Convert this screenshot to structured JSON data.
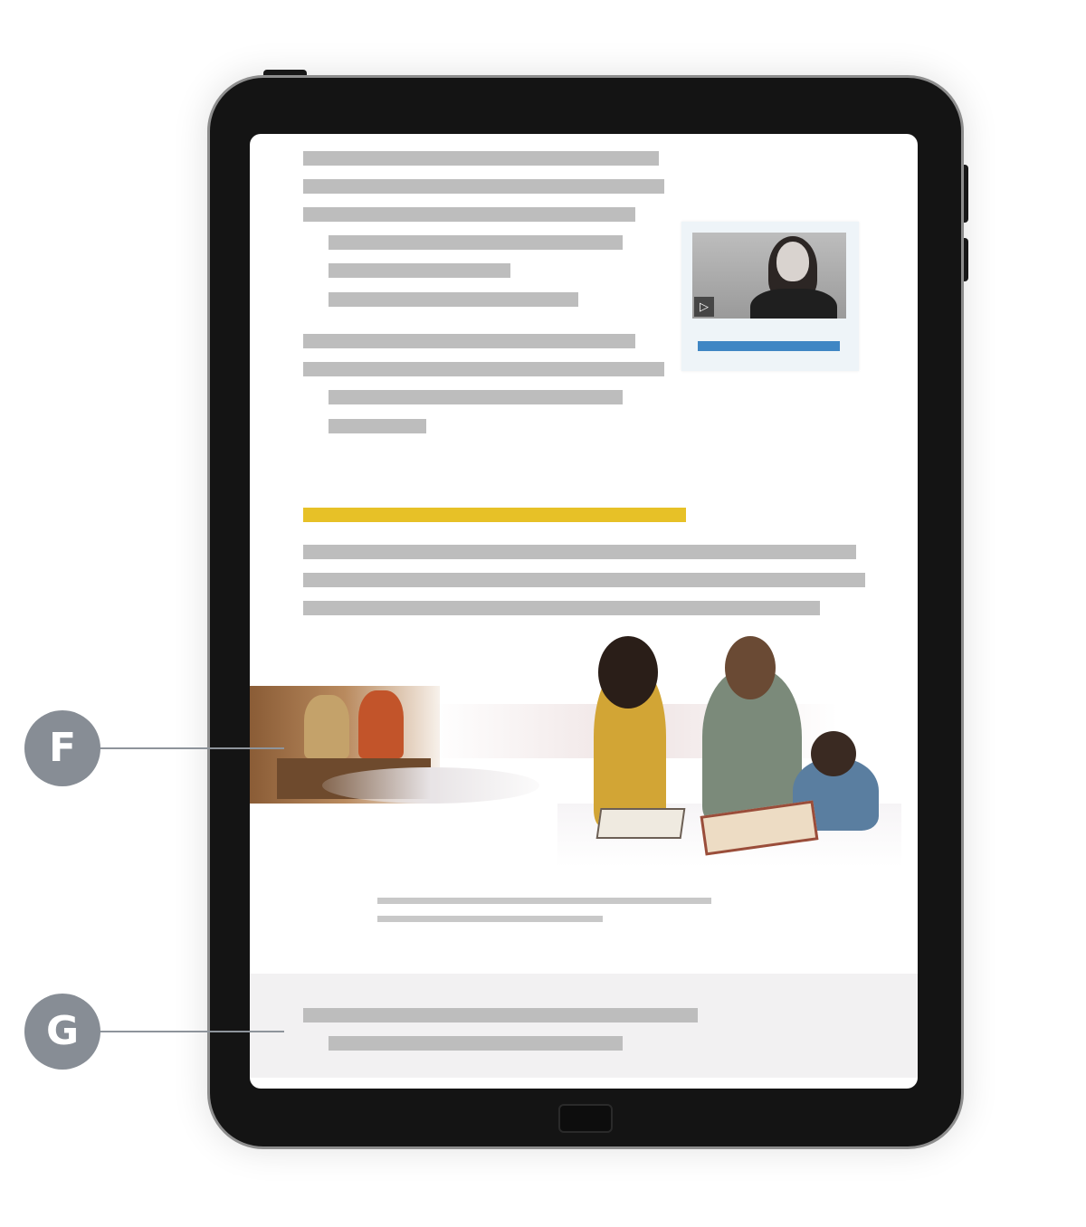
{
  "callouts": [
    {
      "id": "F",
      "label": "F"
    },
    {
      "id": "G",
      "label": "G"
    }
  ],
  "video": {
    "play_icon": "play-icon",
    "play_glyph": "▷",
    "progress_color": "#3f86c4"
  },
  "colors": {
    "heading_highlight": "#e7c127",
    "placeholder_text": "#bdbdbd",
    "callout_badge": "#878d95",
    "footer_band": "#f2f1f2"
  }
}
